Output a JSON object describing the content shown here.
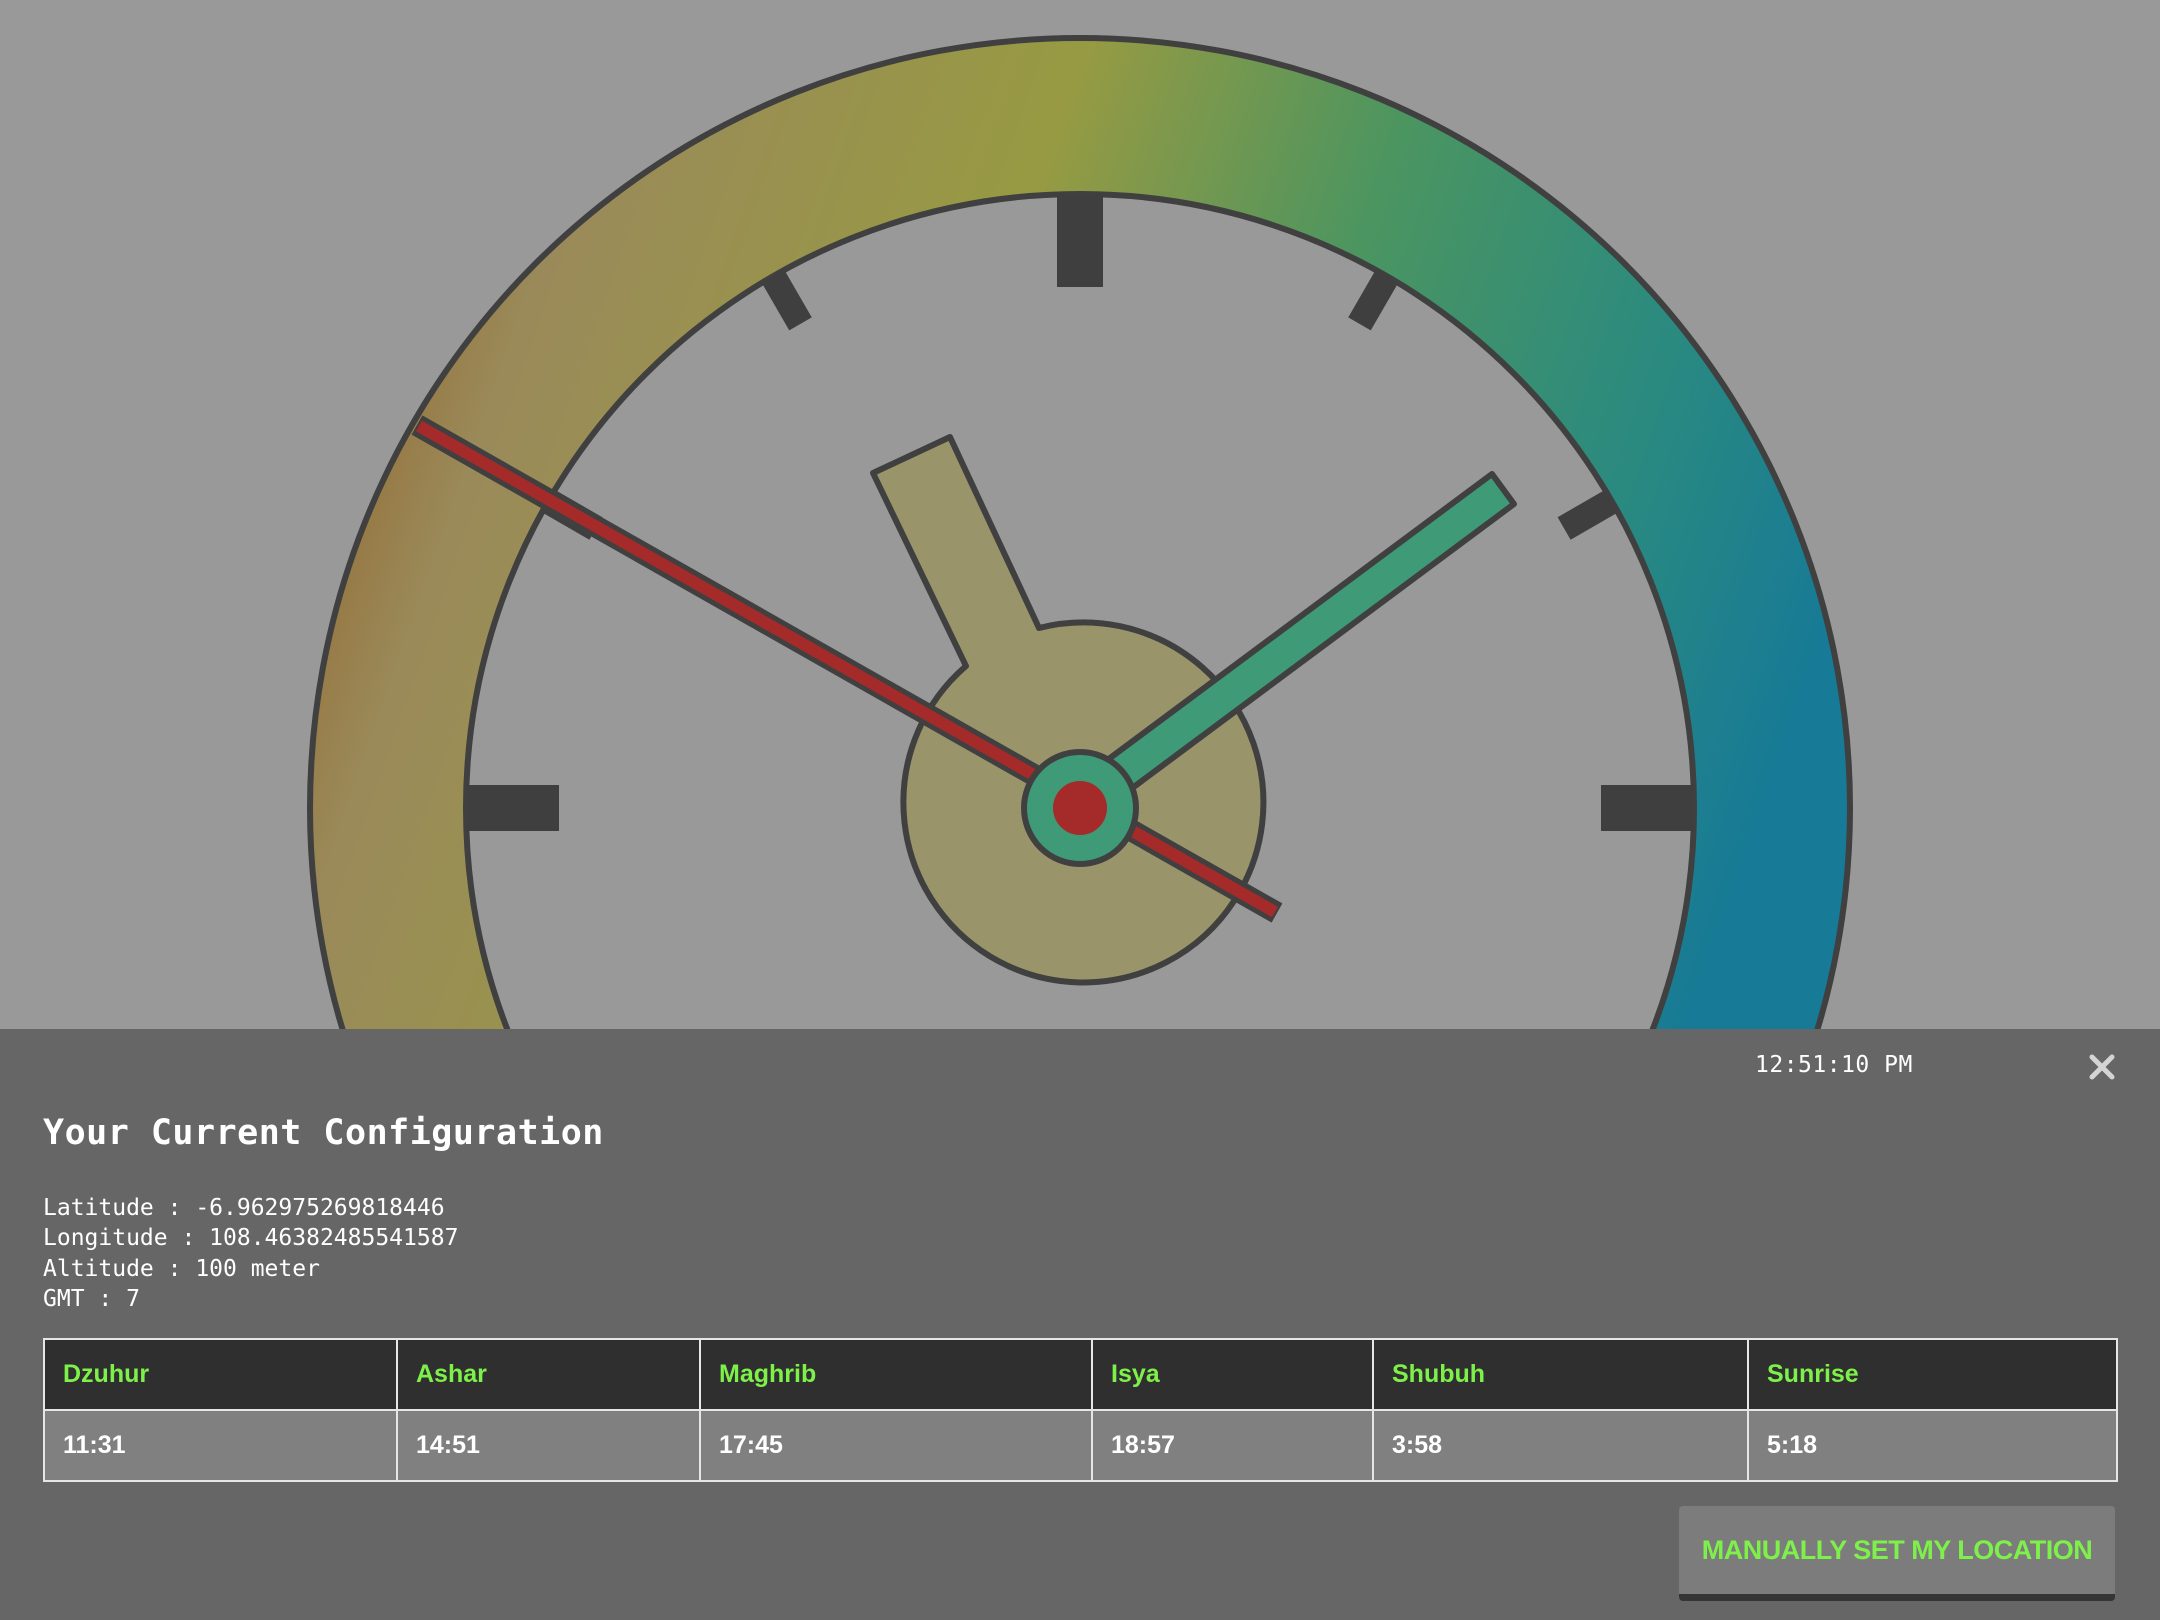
{
  "clock": {
    "type": "analog",
    "colors": {
      "background": "#999999",
      "ring_gradient": [
        "#8f5314",
        "#9a8a5a",
        "#979a42",
        "#4b9560",
        "#2a8a80",
        "#177a96"
      ],
      "hour_hand": "#99946a",
      "minute_hand": "#3f9a78",
      "second_hand": "#a52a2a",
      "tick": "#3f3f3f",
      "outline": "#404040"
    }
  },
  "panel": {
    "time": "12:51:10 PM",
    "close_icon": "close-icon",
    "title": "Your Current Configuration",
    "info": [
      "Latitude : -6.962975269818446",
      "Longitude : 108.46382485541587",
      "Altitude : 100 meter",
      "GMT : 7"
    ],
    "table": {
      "headers": [
        "Dzuhur",
        "Ashar",
        "Maghrib",
        "Isya",
        "Shubuh",
        "Sunrise"
      ],
      "rows": [
        [
          "11:31",
          "14:51",
          "17:45",
          "18:57",
          "3:58",
          "5:18"
        ]
      ]
    },
    "set_location_label": "MANUALLY SET MY LOCATION"
  },
  "colors": {
    "panel_bg": "#666666",
    "accent_green": "#7ef04a",
    "table_header_bg": "#2f2f2f",
    "table_cell_bg": "#808080"
  }
}
